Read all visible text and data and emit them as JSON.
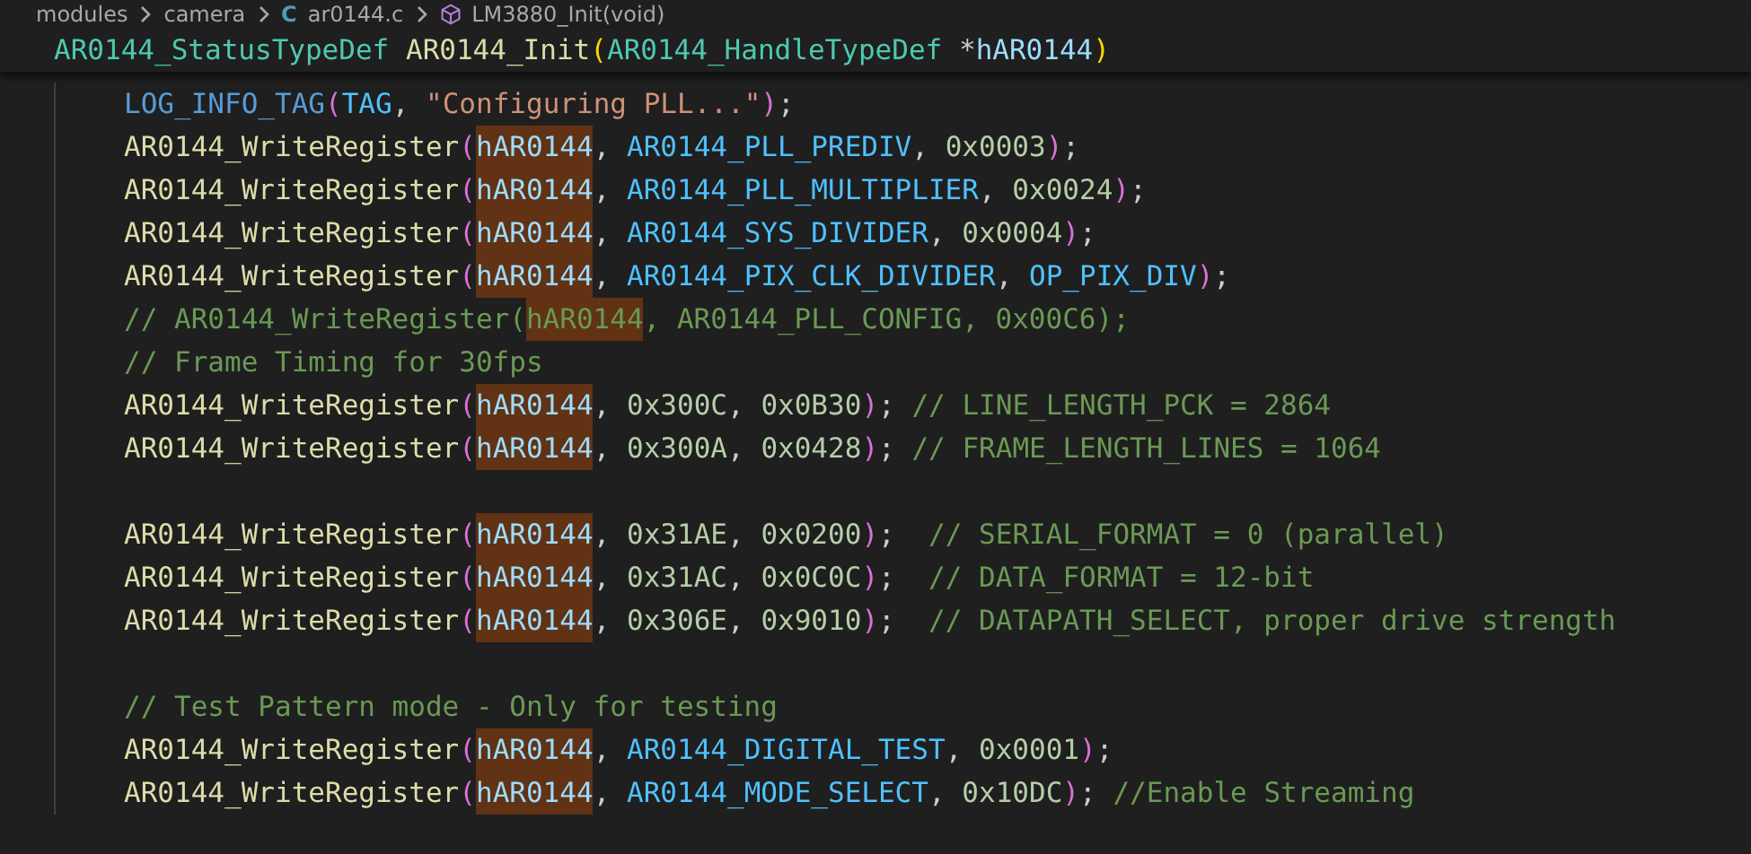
{
  "breadcrumb": [
    {
      "kind": "folder",
      "label": "modules"
    },
    {
      "kind": "folder",
      "label": "camera"
    },
    {
      "kind": "file",
      "glyph": "C",
      "label": "ar0144.c"
    },
    {
      "kind": "symbol",
      "label": "LM3880_Init(void)"
    }
  ],
  "sticky_header": [
    {
      "kind": "type",
      "t": "AR0144_StatusTypeDef"
    },
    {
      "kind": "fn",
      "t": "AR0144_Init"
    },
    {
      "kind": "paren2",
      "t": "("
    },
    {
      "kind": "type",
      "t": "AR0144_HandleTypeDef"
    },
    {
      "kind": "plain",
      "t": "*"
    },
    {
      "kind": "var",
      "t": "hAR0144"
    },
    {
      "kind": "paren2",
      "t": ")"
    }
  ],
  "blocks": [
    [
      [
        {
          "kind": "macro2",
          "t": "LOG_INFO_TAG"
        },
        {
          "kind": "paren1",
          "t": "("
        },
        {
          "kind": "macro",
          "t": "TAG"
        },
        {
          "kind": "plain",
          "t": ","
        },
        {
          "kind": "str",
          "t": "\"Configuring PLL...\""
        },
        {
          "kind": "paren1",
          "t": ")"
        },
        {
          "kind": "plain",
          "t": ";"
        }
      ],
      [
        {
          "kind": "fn",
          "t": "AR0144_WriteRegister"
        },
        {
          "kind": "paren1",
          "t": "("
        },
        {
          "kind": "var_hl",
          "t": "hAR0144"
        },
        {
          "kind": "plain",
          "t": ","
        },
        {
          "kind": "macro",
          "t": "AR0144_PLL_PREDIV"
        },
        {
          "kind": "plain",
          "t": ","
        },
        {
          "kind": "num",
          "t": "0x0003"
        },
        {
          "kind": "paren1",
          "t": ")"
        },
        {
          "kind": "plain",
          "t": ";"
        }
      ],
      [
        {
          "kind": "fn",
          "t": "AR0144_WriteRegister"
        },
        {
          "kind": "paren1",
          "t": "("
        },
        {
          "kind": "var_hl",
          "t": "hAR0144"
        },
        {
          "kind": "plain",
          "t": ","
        },
        {
          "kind": "macro",
          "t": "AR0144_PLL_MULTIPLIER"
        },
        {
          "kind": "plain",
          "t": ","
        },
        {
          "kind": "num",
          "t": "0x0024"
        },
        {
          "kind": "paren1",
          "t": ")"
        },
        {
          "kind": "plain",
          "t": ";"
        }
      ],
      [
        {
          "kind": "fn",
          "t": "AR0144_WriteRegister"
        },
        {
          "kind": "paren1",
          "t": "("
        },
        {
          "kind": "var_hl",
          "t": "hAR0144"
        },
        {
          "kind": "plain",
          "t": ","
        },
        {
          "kind": "macro",
          "t": "AR0144_SYS_DIVIDER"
        },
        {
          "kind": "plain",
          "t": ","
        },
        {
          "kind": "num",
          "t": "0x0004"
        },
        {
          "kind": "paren1",
          "t": ")"
        },
        {
          "kind": "plain",
          "t": ";"
        }
      ],
      [
        {
          "kind": "fn",
          "t": "AR0144_WriteRegister"
        },
        {
          "kind": "paren1",
          "t": "("
        },
        {
          "kind": "var_hl",
          "t": "hAR0144"
        },
        {
          "kind": "plain",
          "t": ","
        },
        {
          "kind": "macro",
          "t": "AR0144_PIX_CLK_DIVIDER"
        },
        {
          "kind": "plain",
          "t": ","
        },
        {
          "kind": "macro",
          "t": "OP_PIX_DIV"
        },
        {
          "kind": "paren1",
          "t": ")"
        },
        {
          "kind": "plain",
          "t": ";"
        }
      ],
      [
        {
          "kind": "comment",
          "t": "// AR0144_WriteRegister("
        },
        {
          "kind": "comment_hl",
          "t": "hAR0144"
        },
        {
          "kind": "comment",
          "t": ", AR0144_PLL_CONFIG, 0x00C6);"
        }
      ],
      [
        {
          "kind": "comment",
          "t": "// Frame Timing for 30fps"
        }
      ],
      [
        {
          "kind": "fn",
          "t": "AR0144_WriteRegister"
        },
        {
          "kind": "paren1",
          "t": "("
        },
        {
          "kind": "var_hl",
          "t": "hAR0144"
        },
        {
          "kind": "plain",
          "t": ","
        },
        {
          "kind": "num",
          "t": "0x300C"
        },
        {
          "kind": "plain",
          "t": ","
        },
        {
          "kind": "num",
          "t": "0x0B30"
        },
        {
          "kind": "paren1",
          "t": ")"
        },
        {
          "kind": "plain",
          "t": ";"
        },
        {
          "kind": "comment",
          "t": "// LINE_LENGTH_PCK = 2864"
        }
      ],
      [
        {
          "kind": "fn",
          "t": "AR0144_WriteRegister"
        },
        {
          "kind": "paren1",
          "t": "("
        },
        {
          "kind": "var_hl",
          "t": "hAR0144"
        },
        {
          "kind": "plain",
          "t": ","
        },
        {
          "kind": "num",
          "t": "0x300A"
        },
        {
          "kind": "plain",
          "t": ","
        },
        {
          "kind": "num",
          "t": "0x0428"
        },
        {
          "kind": "paren1",
          "t": ")"
        },
        {
          "kind": "plain",
          "t": ";"
        },
        {
          "kind": "comment",
          "t": "// FRAME_LENGTH_LINES = 1064"
        }
      ]
    ],
    [
      [
        {
          "kind": "fn",
          "t": "AR0144_WriteRegister"
        },
        {
          "kind": "paren1",
          "t": "("
        },
        {
          "kind": "var_hl",
          "t": "hAR0144"
        },
        {
          "kind": "plain",
          "t": ","
        },
        {
          "kind": "num",
          "t": "0x31AE"
        },
        {
          "kind": "plain",
          "t": ","
        },
        {
          "kind": "num",
          "t": "0x0200"
        },
        {
          "kind": "paren1",
          "t": ")"
        },
        {
          "kind": "plain",
          "t": ";"
        },
        {
          "kind": "comment",
          "t": "// SERIAL_FORMAT = 0 (parallel)"
        }
      ],
      [
        {
          "kind": "fn",
          "t": "AR0144_WriteRegister"
        },
        {
          "kind": "paren1",
          "t": "("
        },
        {
          "kind": "var_hl",
          "t": "hAR0144"
        },
        {
          "kind": "plain",
          "t": ","
        },
        {
          "kind": "num",
          "t": "0x31AC"
        },
        {
          "kind": "plain",
          "t": ","
        },
        {
          "kind": "num",
          "t": "0x0C0C"
        },
        {
          "kind": "paren1",
          "t": ")"
        },
        {
          "kind": "plain",
          "t": ";"
        },
        {
          "kind": "comment",
          "t": "// DATA_FORMAT = 12-bit"
        }
      ],
      [
        {
          "kind": "fn",
          "t": "AR0144_WriteRegister"
        },
        {
          "kind": "paren1",
          "t": "("
        },
        {
          "kind": "var_hl",
          "t": "hAR0144"
        },
        {
          "kind": "plain",
          "t": ","
        },
        {
          "kind": "num",
          "t": "0x306E"
        },
        {
          "kind": "plain",
          "t": ","
        },
        {
          "kind": "num",
          "t": "0x9010"
        },
        {
          "kind": "paren1",
          "t": ")"
        },
        {
          "kind": "plain",
          "t": ";"
        },
        {
          "kind": "comment",
          "t": "// DATAPATH_SELECT, proper drive strength"
        }
      ]
    ],
    [
      [
        {
          "kind": "comment",
          "t": "// Test Pattern mode - Only for testing"
        }
      ],
      [
        {
          "kind": "fn",
          "t": "AR0144_WriteRegister"
        },
        {
          "kind": "paren1",
          "t": "("
        },
        {
          "kind": "var_hl",
          "t": "hAR0144"
        },
        {
          "kind": "plain",
          "t": ","
        },
        {
          "kind": "macro",
          "t": "AR0144_DIGITAL_TEST"
        },
        {
          "kind": "plain",
          "t": ","
        },
        {
          "kind": "num",
          "t": "0x0001"
        },
        {
          "kind": "paren1",
          "t": ")"
        },
        {
          "kind": "plain",
          "t": ";"
        }
      ],
      [
        {
          "kind": "fn",
          "t": "AR0144_WriteRegister"
        },
        {
          "kind": "paren1",
          "t": "("
        },
        {
          "kind": "var_hl",
          "t": "hAR0144"
        },
        {
          "kind": "plain",
          "t": ","
        },
        {
          "kind": "macro",
          "t": "AR0144_MODE_SELECT"
        },
        {
          "kind": "plain",
          "t": ","
        },
        {
          "kind": "num",
          "t": "0x10DC"
        },
        {
          "kind": "paren1",
          "t": ")"
        },
        {
          "kind": "plain",
          "t": ";"
        },
        {
          "kind": "comment",
          "t": "//Enable Streaming"
        }
      ]
    ]
  ]
}
